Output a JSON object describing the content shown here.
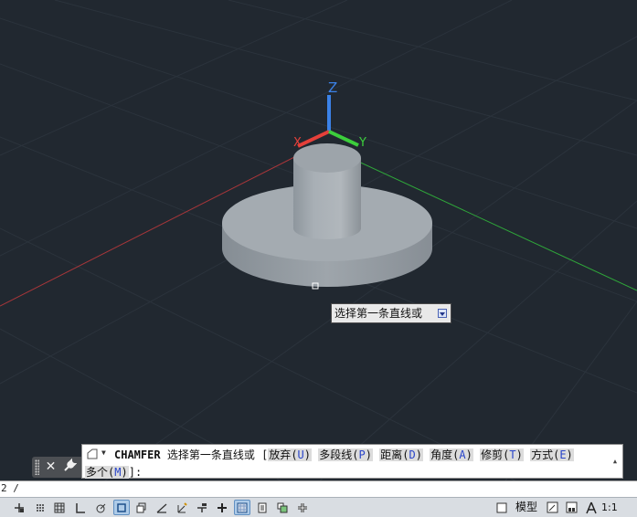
{
  "viewport": {
    "background": "#212830",
    "axis_labels": {
      "x": "X",
      "y": "Y",
      "z": "Z"
    },
    "axis_colors": {
      "x": "#e5403a",
      "y": "#3ccf3c",
      "z": "#3b82e8"
    }
  },
  "tooltip": {
    "text": "选择第一条直线或"
  },
  "command_line": {
    "command": "CHAMFER",
    "prompt": "选择第一条直线或",
    "open_bracket": "[",
    "options": [
      {
        "label": "放弃",
        "key": "U"
      },
      {
        "label": "多段线",
        "key": "P"
      },
      {
        "label": "距离",
        "key": "D"
      },
      {
        "label": "角度",
        "key": "A"
      },
      {
        "label": "修剪",
        "key": "T"
      },
      {
        "label": "方式",
        "key": "E"
      }
    ],
    "line2": {
      "label": "多个",
      "key": "M",
      "suffix": "]:"
    },
    "history_text": "2 /"
  },
  "statusbar": {
    "model_label": "模型",
    "scale_label": "1:1",
    "icons": [
      {
        "name": "infer-constraints-icon",
        "on": false
      },
      {
        "name": "snap-mode-icon",
        "on": false
      },
      {
        "name": "grid-display-icon",
        "on": false
      },
      {
        "name": "ortho-mode-icon",
        "on": false
      },
      {
        "name": "polar-tracking-icon",
        "on": false
      },
      {
        "name": "object-snap-icon",
        "on": true
      },
      {
        "name": "3d-object-snap-icon",
        "on": false
      },
      {
        "name": "object-snap-tracking-icon",
        "on": false
      },
      {
        "name": "dynamic-ucs-icon",
        "on": false
      },
      {
        "name": "dynamic-input-icon",
        "on": false
      },
      {
        "name": "lineweight-icon",
        "on": false
      },
      {
        "name": "transparency-icon",
        "on": true
      },
      {
        "name": "quick-properties-icon",
        "on": false
      },
      {
        "name": "selection-cycling-icon",
        "on": false
      },
      {
        "name": "annotation-monitor-icon",
        "on": false
      }
    ]
  }
}
